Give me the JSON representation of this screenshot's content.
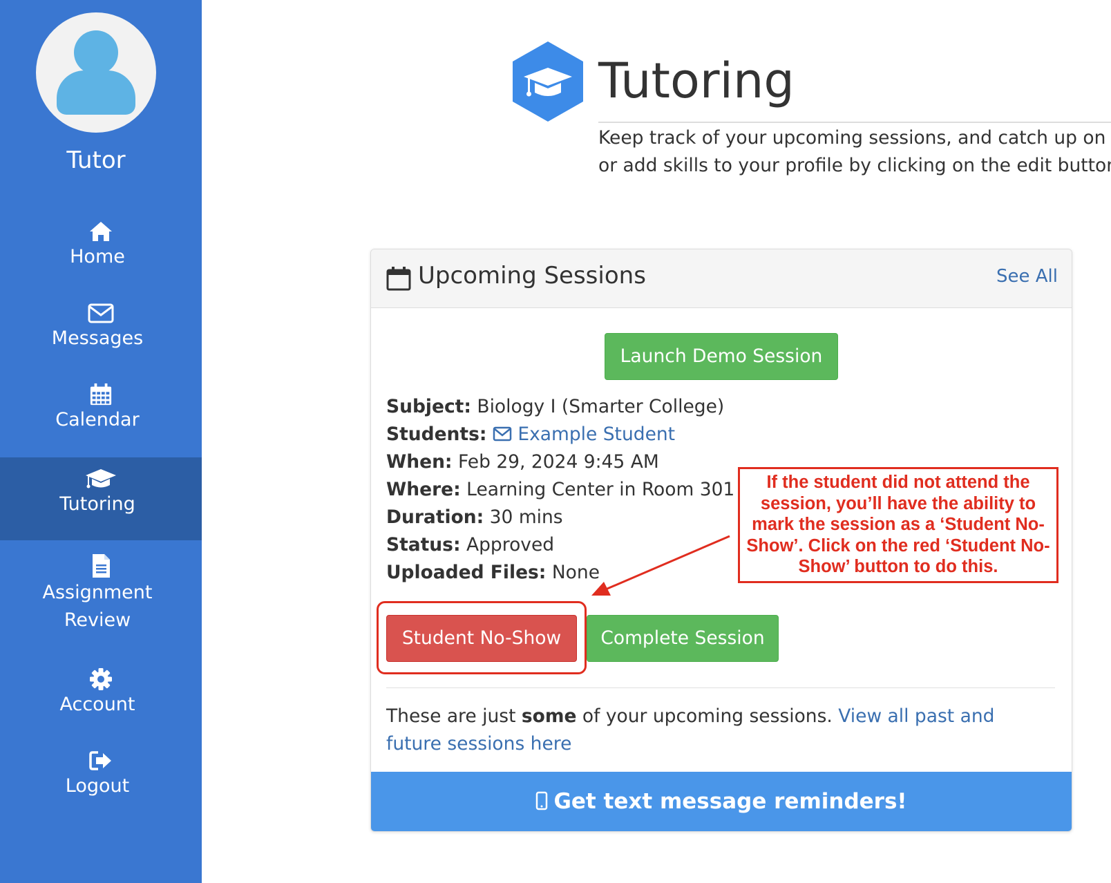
{
  "sidebar": {
    "role": "Tutor",
    "items": [
      {
        "label": "Home",
        "icon": "home-icon"
      },
      {
        "label": "Messages",
        "icon": "envelope-icon"
      },
      {
        "label": "Calendar",
        "icon": "calendar-icon"
      },
      {
        "label": "Tutoring",
        "icon": "graduation-cap-icon",
        "active": true
      },
      {
        "label": "Assignment Review",
        "line1": "Assignment",
        "line2": "Review",
        "icon": "document-icon"
      },
      {
        "label": "Account",
        "icon": "gear-icon"
      },
      {
        "label": "Logout",
        "icon": "logout-icon"
      }
    ]
  },
  "header": {
    "title": "Tutoring",
    "intro_line1": "Keep track of your upcoming sessions, and catch up on y",
    "intro_line2": "or add skills to your profile by clicking on the edit button i"
  },
  "panel": {
    "title": "Upcoming Sessions",
    "see_all": "See All",
    "demo_button": "Launch Demo Session",
    "session": {
      "subject_label": "Subject:",
      "subject": "Biology I (Smarter College)",
      "students_label": "Students:",
      "student": "Example Student",
      "when_label": "When:",
      "when": "Feb 29, 2024 9:45 AM",
      "where_label": "Where:",
      "where": "Learning Center in Room 301",
      "duration_label": "Duration:",
      "duration": "30 mins",
      "status_label": "Status:",
      "status": "Approved",
      "files_label": "Uploaded Files:",
      "files": "None"
    },
    "noshow_button": "Student No-Show",
    "complete_button": "Complete Session",
    "footer_pre": "These are just ",
    "footer_bold": "some",
    "footer_mid": " of your upcoming sessions. ",
    "footer_link": "View all past and future sessions here",
    "sms_label": "Get text message reminders!"
  },
  "annotation": {
    "text": "If the student did not attend the session, you’ll have the ability to mark the session as a ‘Student No-Show’. Click on the red ‘Student No-Show’ button to do this.",
    "color": "#e02d1f"
  },
  "colors": {
    "sidebar": "#3a77d1",
    "sidebar_active": "#2c5ea5",
    "green": "#5cb85c",
    "red": "#d9534f",
    "link": "#3a6fb0",
    "sms_bar": "#4a96e9"
  }
}
